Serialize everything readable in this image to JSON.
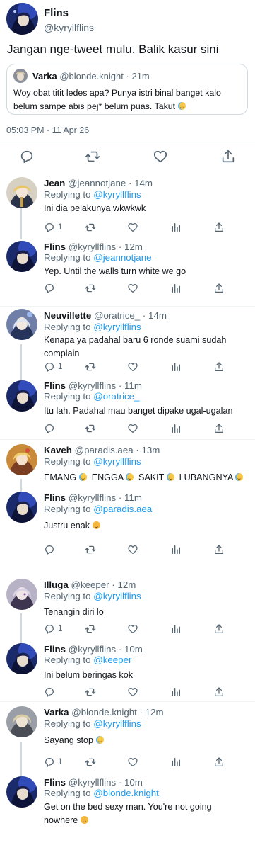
{
  "main_tweet": {
    "author": {
      "name": "Flins",
      "handle": "@kyryllflins"
    },
    "text": "Jangan nge-tweet mulu. Balik kasur sini",
    "quote": {
      "name": "Varka",
      "handle": "@blonde.knight",
      "dot": "·",
      "age": "21m",
      "text": "Woy obat titit ledes apa? Punya istri binal banget kalo belum sampe abis pej* belum puas. Takut"
    },
    "timestamp": "05:03 PM · 11 Apr 26"
  },
  "replies": [
    {
      "name": "Jean",
      "handle": "@jeannotjane",
      "dot": "·",
      "age": "14m",
      "replying_prefix": "Replying to",
      "mention": "@kyryllflins",
      "text": "Ini dia pelakunya wkwkwk",
      "reply_count": "1",
      "text_emoji": ""
    },
    {
      "name": "Flins",
      "handle": "@kyryllflins",
      "dot": "·",
      "age": "12m",
      "replying_prefix": "Replying to",
      "mention": "@jeannotjane",
      "text": "Yep. Until the walls turn white we go",
      "reply_count": "",
      "text_emoji": ""
    },
    {
      "name": "Neuvillette",
      "handle": "@oratrice_",
      "dot": "·",
      "age": "14m",
      "replying_prefix": "Replying to",
      "mention": "@kyryllflins",
      "text": "Kenapa ya padahal baru 6 ronde suami sudah complain",
      "reply_count": "1",
      "text_emoji": ""
    },
    {
      "name": "Flins",
      "handle": "@kyryllflins",
      "dot": "·",
      "age": "11m",
      "replying_prefix": "Replying to",
      "mention": "@oratrice_",
      "text": "Itu lah. Padahal mau banget dipake ugal-ugalan",
      "reply_count": "",
      "text_emoji": ""
    },
    {
      "name": "Kaveh",
      "handle": "@paradis.aea",
      "dot": "·",
      "age": "13m",
      "replying_prefix": "Replying to",
      "mention": "@kyryllflins",
      "text_parts": [
        "EMANG",
        "ENGGA",
        "SAKIT",
        "LUBANGNYA"
      ],
      "reply_count": "1",
      "text_emoji": "cry"
    },
    {
      "name": "Flins",
      "handle": "@kyryllflins",
      "dot": "·",
      "age": "11m",
      "replying_prefix": "Replying to",
      "mention": "@paradis.aea",
      "text": "Justru enak",
      "reply_count": "",
      "text_emoji": "smile"
    },
    {
      "name": "Illuga",
      "handle": "@keeper",
      "dot": "·",
      "age": "12m",
      "replying_prefix": "Replying to",
      "mention": "@kyryllflins",
      "text": "Tenangin diri lo",
      "reply_count": "1",
      "text_emoji": ""
    },
    {
      "name": "Flins",
      "handle": "@kyryllflins",
      "dot": "·",
      "age": "10m",
      "replying_prefix": "Replying to",
      "mention": "@keeper",
      "text": "Ini belum beringas kok",
      "reply_count": "",
      "text_emoji": ""
    },
    {
      "name": "Varka",
      "handle": "@blonde.knight",
      "dot": "·",
      "age": "12m",
      "replying_prefix": "Replying to",
      "mention": "@kyryllflins",
      "text": "Sayang stop",
      "reply_count": "1",
      "text_emoji": "cry"
    },
    {
      "name": "Flins",
      "handle": "@kyryllflins",
      "dot": "·",
      "age": "10m",
      "replying_prefix": "Replying to",
      "mention": "@blonde.knight",
      "text": "Get on the bed sexy man. You're not going nowhere",
      "reply_count": "",
      "text_emoji": "smirk"
    }
  ],
  "colors": {
    "text": "#0f1419",
    "secondary": "#536471",
    "link": "#1d9bf0",
    "border": "#cfd9de",
    "divider": "#eff3f4"
  },
  "icons": [
    "reply-icon",
    "retweet-icon",
    "like-icon",
    "views-icon",
    "share-icon"
  ]
}
